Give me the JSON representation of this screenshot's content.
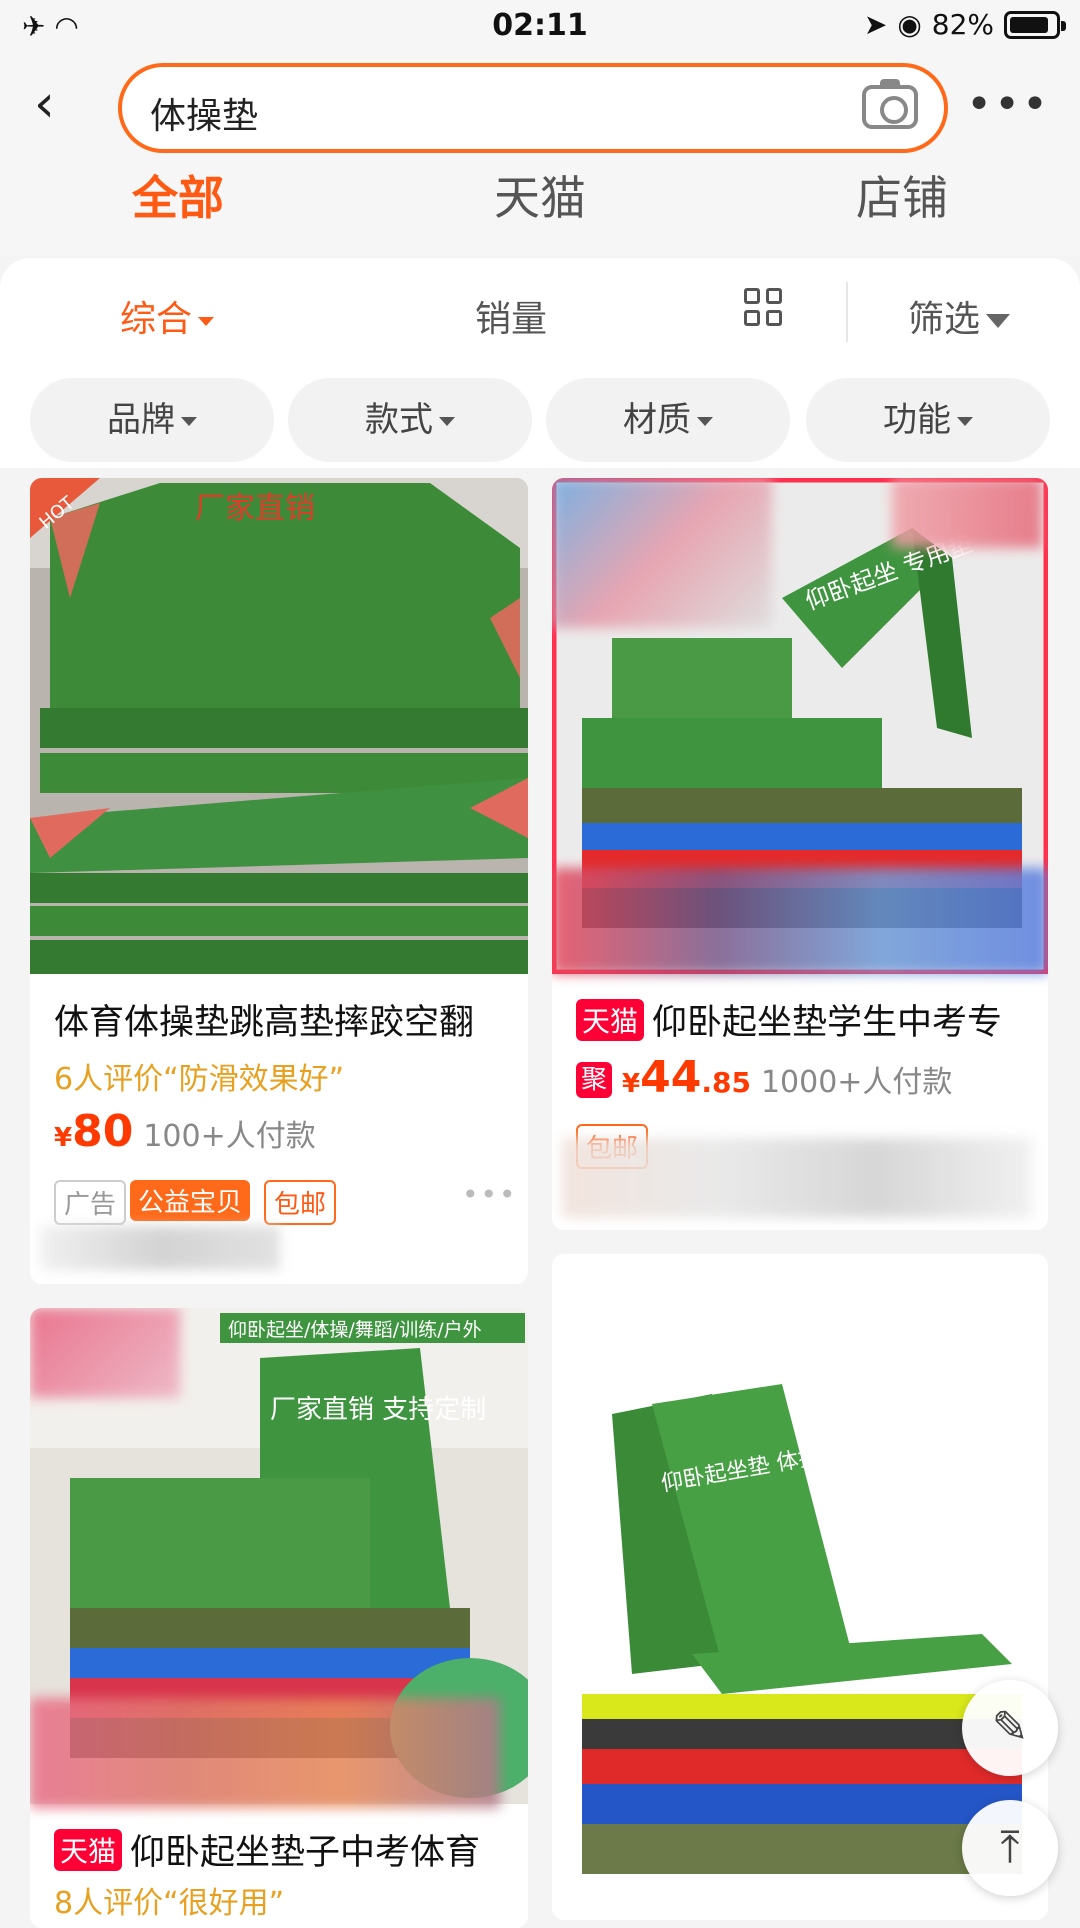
{
  "status": {
    "time": "02:11",
    "battery": "82%"
  },
  "search": {
    "query": "体操垫"
  },
  "scope_tabs": [
    {
      "label": "全部",
      "active": true
    },
    {
      "label": "天猫",
      "active": false
    },
    {
      "label": "店铺",
      "active": false
    }
  ],
  "sort": {
    "comprehensive": "综合",
    "sales": "销量",
    "filter": "筛选"
  },
  "chips": [
    "品牌",
    "款式",
    "材质",
    "功能"
  ],
  "products": [
    {
      "title": "体育体操垫跳高垫摔跤空翻",
      "review": "6人评价“防滑效果好”",
      "price_currency": "¥",
      "price_int": "80",
      "paid": "100+人付款",
      "tags": [
        "广告",
        "公益宝贝",
        "包邮"
      ],
      "image_overlay": "厂家直销",
      "image_badge": "HOT"
    },
    {
      "tmall_badge": "天猫",
      "title": "仰卧起坐垫学生中考专",
      "ju_badge": "聚",
      "price_currency": "¥",
      "price_int": "44",
      "price_dec": ".85",
      "paid": "1000+人付款",
      "tag": "包邮",
      "image_text": "仰卧起坐 专用垫"
    },
    {
      "tmall_badge": "天猫",
      "title": "仰卧起坐垫子中考体育",
      "review": "8人评价“很好用”",
      "image_banner": "仰卧起坐/体操/舞蹈/训练/户外",
      "image_text": "厂家直销 支持定制"
    },
    {
      "image_text": "仰卧起坐垫 体操专用垫 舞蹈练功垫"
    }
  ],
  "colors": {
    "accent": "#ff5a14",
    "tmall": "#ff0036",
    "mat_green": "#3f8f3a"
  },
  "icons": [
    "back-icon",
    "camera-icon",
    "more-icon",
    "grid-view-icon",
    "filter-icon",
    "feedback-icon",
    "back-to-top-icon"
  ]
}
